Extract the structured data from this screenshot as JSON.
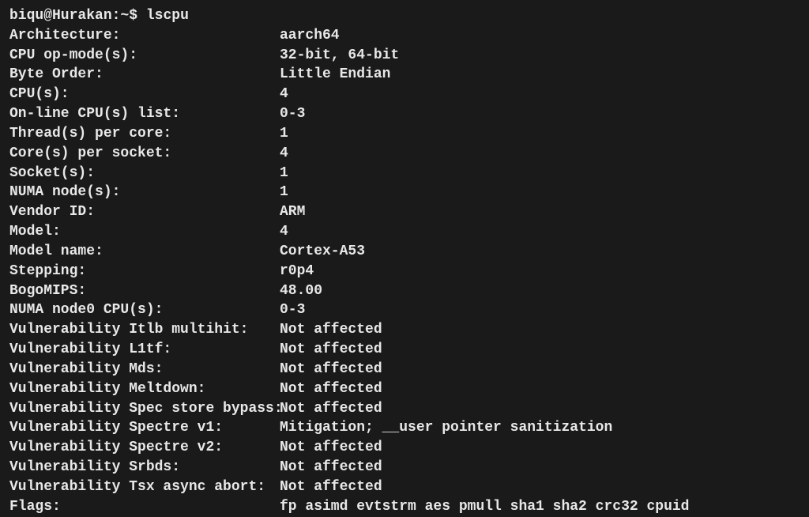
{
  "prompt": {
    "user_host": "biqu@Hurakan",
    "path": "~",
    "separator": "$",
    "command": "lscpu"
  },
  "lscpu": {
    "rows": [
      {
        "field": "Architecture:",
        "value": "aarch64"
      },
      {
        "field": "CPU op-mode(s):",
        "value": "32-bit, 64-bit"
      },
      {
        "field": "Byte Order:",
        "value": "Little Endian"
      },
      {
        "field": "CPU(s):",
        "value": "4"
      },
      {
        "field": "On-line CPU(s) list:",
        "value": "0-3"
      },
      {
        "field": "Thread(s) per core:",
        "value": "1"
      },
      {
        "field": "Core(s) per socket:",
        "value": "4"
      },
      {
        "field": "Socket(s):",
        "value": "1"
      },
      {
        "field": "NUMA node(s):",
        "value": "1"
      },
      {
        "field": "Vendor ID:",
        "value": "ARM"
      },
      {
        "field": "Model:",
        "value": "4"
      },
      {
        "field": "Model name:",
        "value": "Cortex-A53"
      },
      {
        "field": "Stepping:",
        "value": "r0p4"
      },
      {
        "field": "BogoMIPS:",
        "value": "48.00"
      },
      {
        "field": "NUMA node0 CPU(s):",
        "value": "0-3"
      },
      {
        "field": "Vulnerability Itlb multihit:",
        "value": "Not affected"
      },
      {
        "field": "Vulnerability L1tf:",
        "value": "Not affected"
      },
      {
        "field": "Vulnerability Mds:",
        "value": "Not affected"
      },
      {
        "field": "Vulnerability Meltdown:",
        "value": "Not affected"
      },
      {
        "field": "Vulnerability Spec store bypass:",
        "value": "Not affected"
      },
      {
        "field": "Vulnerability Spectre v1:",
        "value": "Mitigation; __user pointer sanitization"
      },
      {
        "field": "Vulnerability Spectre v2:",
        "value": "Not affected"
      },
      {
        "field": "Vulnerability Srbds:",
        "value": "Not affected"
      },
      {
        "field": "Vulnerability Tsx async abort:",
        "value": "Not affected"
      },
      {
        "field": "Flags:",
        "value": "fp asimd evtstrm aes pmull sha1 sha2 crc32 cpuid"
      }
    ]
  }
}
